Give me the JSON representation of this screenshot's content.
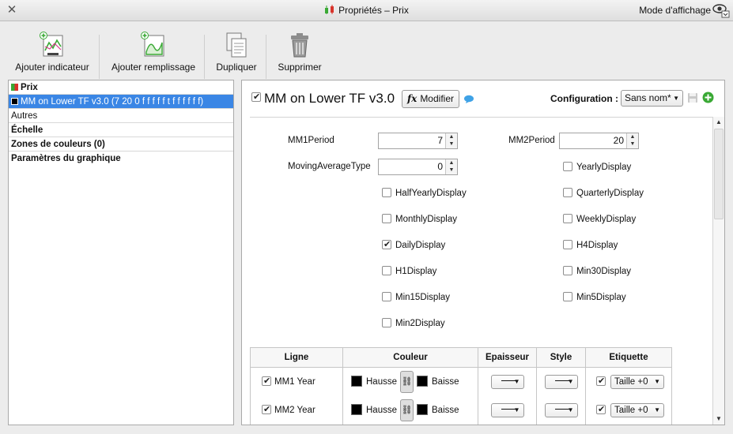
{
  "window": {
    "title": "Propriétés – Prix",
    "mode_label": "Mode d'affichage",
    "close_glyph": "✕"
  },
  "toolbar": {
    "items": [
      {
        "label": "Ajouter indicateur",
        "icon": "add-indicator-icon"
      },
      {
        "label": "Ajouter remplissage",
        "icon": "add-fill-icon"
      },
      {
        "label": "Dupliquer",
        "icon": "duplicate-icon"
      },
      {
        "label": "Supprimer",
        "icon": "trash-icon"
      }
    ]
  },
  "sidebar": {
    "items": [
      {
        "label": "Prix",
        "bold": true,
        "swatch": "price-swatch"
      },
      {
        "label": "MM on Lower TF v3.0 (7 20 0 f f f f f t f f f f f f)",
        "selected": true,
        "swatch_color": "#000000"
      },
      {
        "label": "Autres"
      },
      {
        "label": "Échelle",
        "bold": true
      },
      {
        "label": "Zones de couleurs (0)",
        "bold": true
      },
      {
        "label": "Paramètres du graphique",
        "bold": true
      }
    ]
  },
  "indicator": {
    "name": "MM on Lower TF v3.0",
    "enabled": true,
    "modify_label": "Modifier",
    "fx_glyph": "fx",
    "config_label": "Configuration :",
    "config_value": "Sans nom*"
  },
  "params": {
    "mm1_label": "MM1Period",
    "mm1_value": "7",
    "mm2_label": "MM2Period",
    "mm2_value": "20",
    "mat_label": "MovingAverageType",
    "mat_value": "0"
  },
  "checkboxes": {
    "yearly": {
      "label": "YearlyDisplay",
      "checked": false
    },
    "halfyearly": {
      "label": "HalfYearlyDisplay",
      "checked": false
    },
    "quarterly": {
      "label": "QuarterlyDisplay",
      "checked": false
    },
    "monthly": {
      "label": "MonthlyDisplay",
      "checked": false
    },
    "weekly": {
      "label": "WeeklyDisplay",
      "checked": false
    },
    "daily": {
      "label": "DailyDisplay",
      "checked": true
    },
    "h4": {
      "label": "H4Display",
      "checked": false
    },
    "h1": {
      "label": "H1Display",
      "checked": false
    },
    "min30": {
      "label": "Min30Display",
      "checked": false
    },
    "min15": {
      "label": "Min15Display",
      "checked": false
    },
    "min5": {
      "label": "Min5Display",
      "checked": false
    },
    "min2": {
      "label": "Min2Display",
      "checked": false
    }
  },
  "lines_table": {
    "headers": [
      "Ligne",
      "Couleur",
      "Epaisseur",
      "Style",
      "Etiquette"
    ],
    "rows": [
      {
        "name": "MM1 Year",
        "enabled": true,
        "up_label": "Hausse",
        "down_label": "Baisse",
        "up_color": "#000000",
        "down_color": "#000000",
        "label_enabled": true,
        "label_size": "Taille +0"
      },
      {
        "name": "MM2 Year",
        "enabled": true,
        "up_label": "Hausse",
        "down_label": "Baisse",
        "up_color": "#000000",
        "down_color": "#000000",
        "label_enabled": true,
        "label_size": "Taille +0"
      }
    ]
  },
  "colors": {
    "selection": "#3a86e5",
    "add_green": "#3aa935"
  }
}
